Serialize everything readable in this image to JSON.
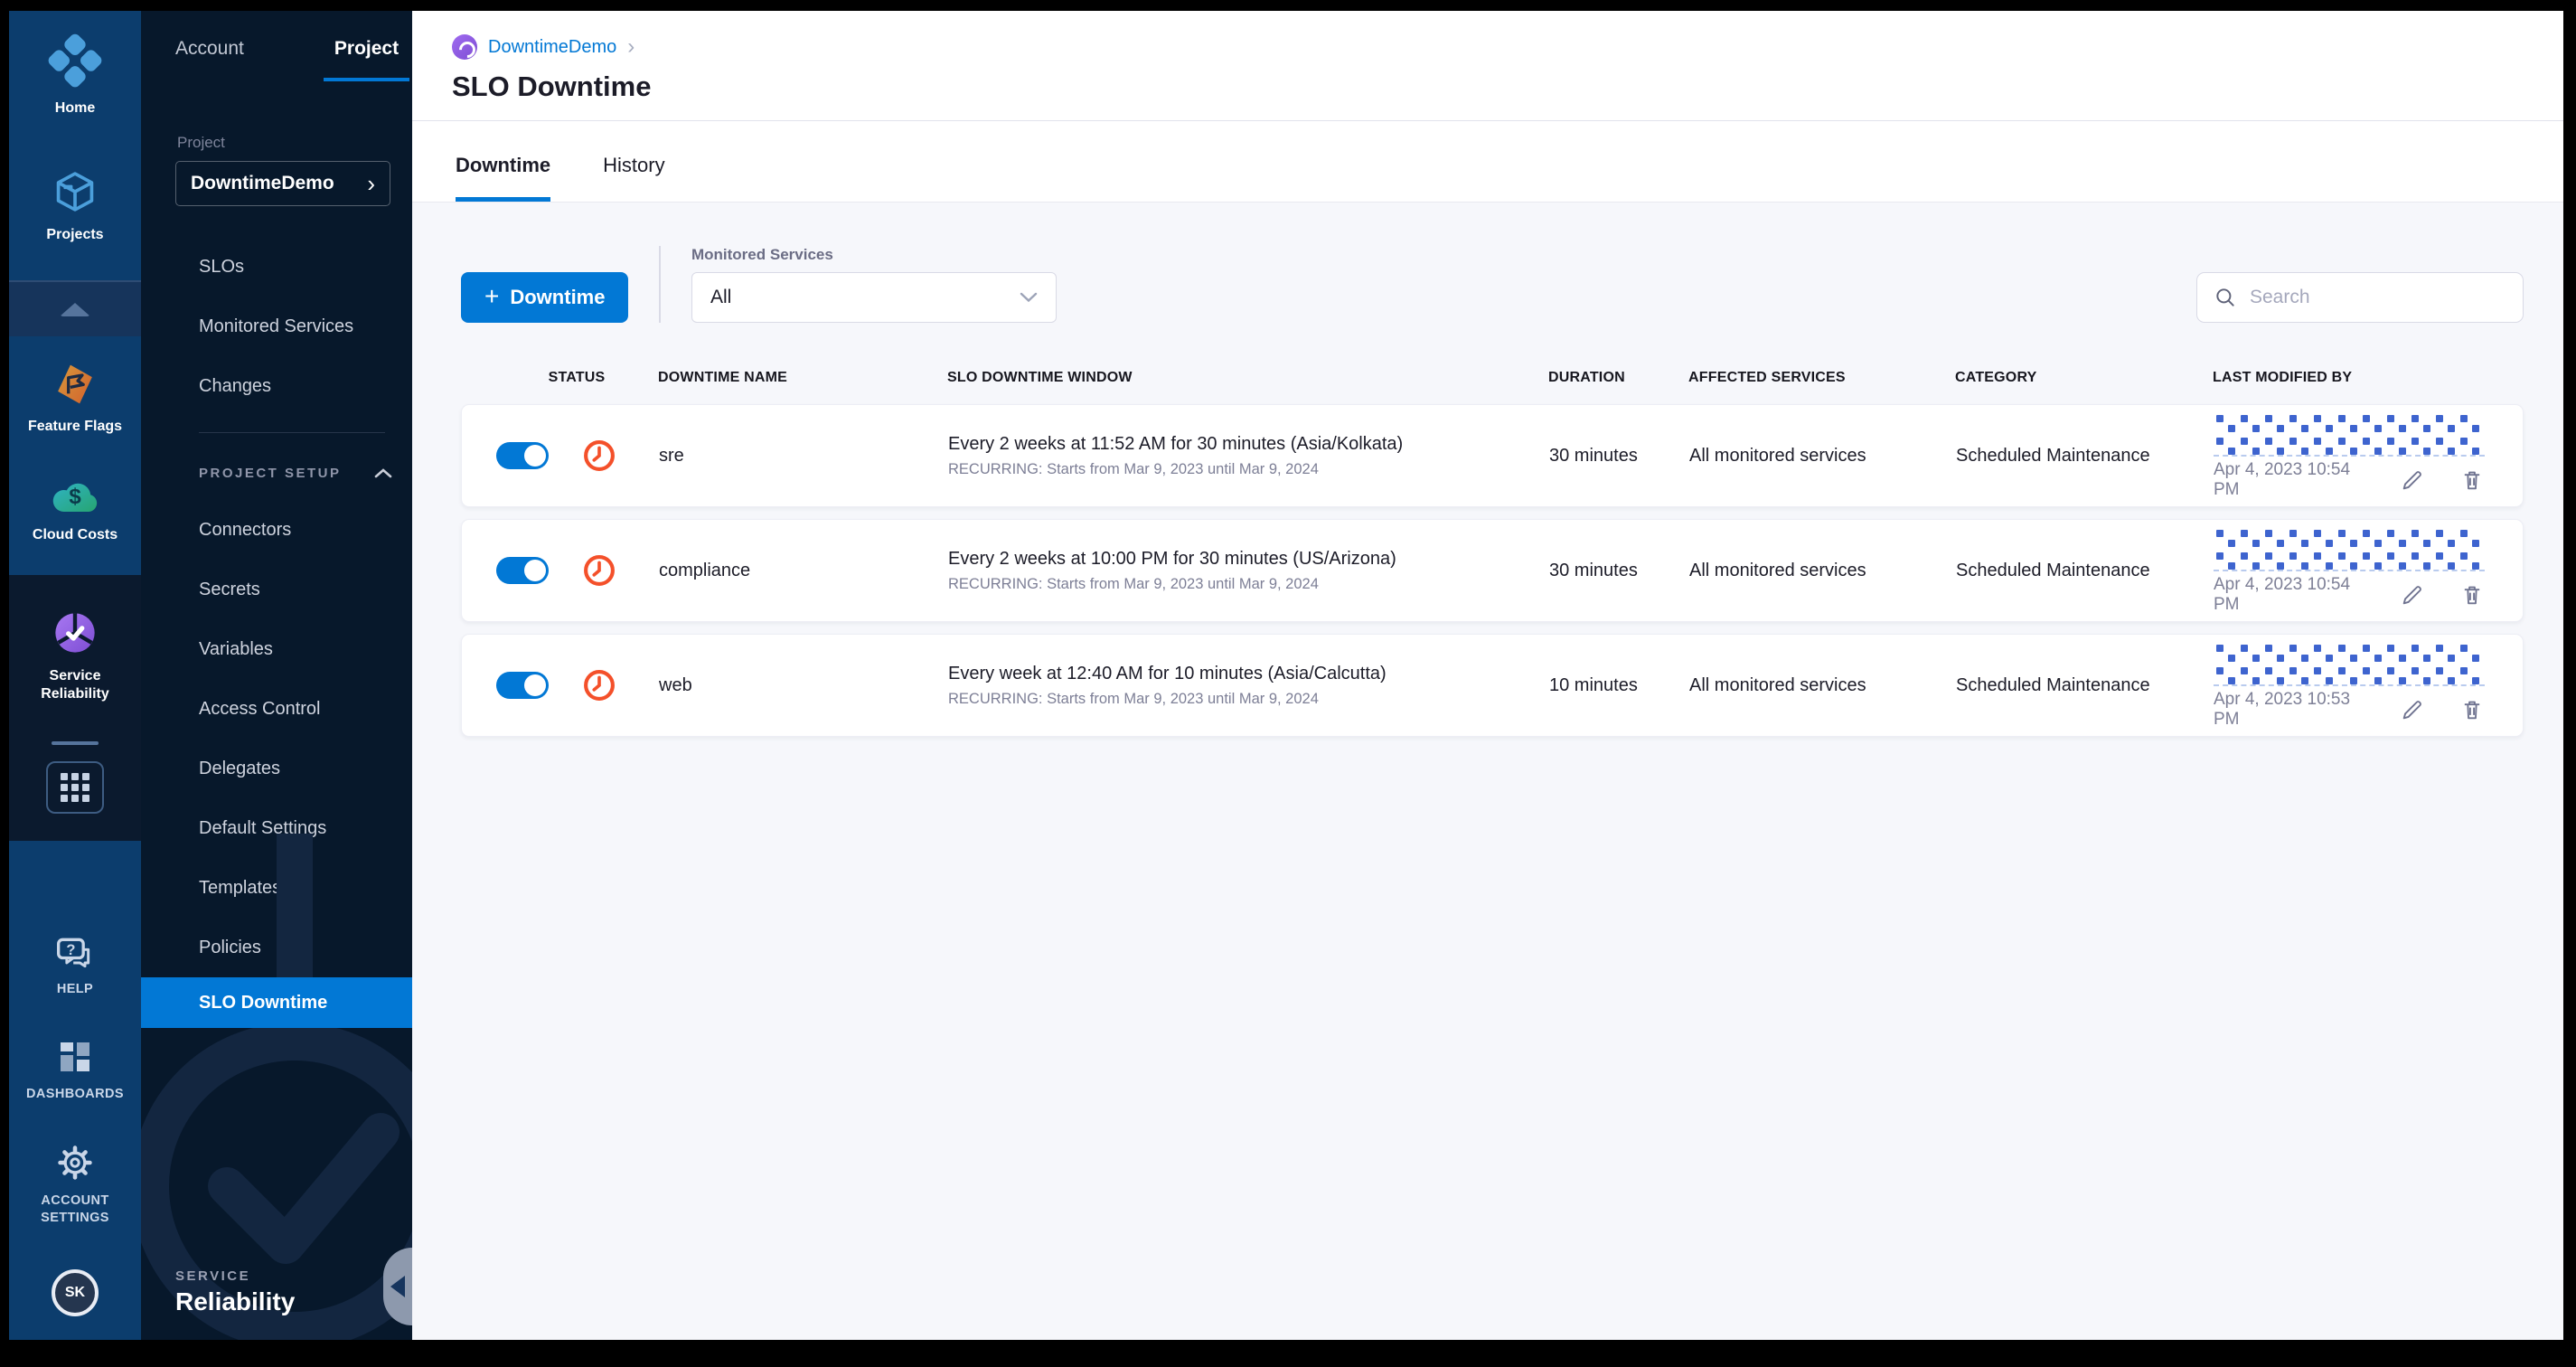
{
  "rail": {
    "home": {
      "label": "Home"
    },
    "projects": {
      "label": "Projects"
    },
    "modules": [
      {
        "label": "Feature Flags"
      },
      {
        "label": "Cloud Costs"
      },
      {
        "label": "Service Reliability",
        "selected": true
      }
    ],
    "help_label": "HELP",
    "dashboards_label": "DASHBOARDS",
    "account_settings_label_1": "ACCOUNT",
    "account_settings_label_2": "SETTINGS",
    "avatar_initials": "SK"
  },
  "nav": {
    "account_tab": "Account",
    "project_tab": "Project",
    "project_field_label": "Project",
    "project_name": "DowntimeDemo",
    "items": [
      "SLOs",
      "Monitored Services",
      "Changes"
    ],
    "section_label": "PROJECT SETUP",
    "setup_items": [
      "Connectors",
      "Secrets",
      "Variables",
      "Access Control",
      "Delegates",
      "Default Settings",
      "Templates",
      "Policies"
    ],
    "selected_item": "SLO Downtime",
    "brand_top": "SERVICE",
    "brand_bottom": "Reliability"
  },
  "header": {
    "breadcrumb_project": "DowntimeDemo",
    "breadcrumb_chevron": "›",
    "title": "SLO Downtime"
  },
  "page_tabs": [
    {
      "label": "Downtime",
      "active": true
    },
    {
      "label": "History",
      "active": false
    }
  ],
  "toolbar": {
    "plus": "+",
    "new_downtime_label": "Downtime",
    "filter_label": "Monitored Services",
    "filter_value": "All",
    "search_placeholder": "Search"
  },
  "table": {
    "headers": [
      "STATUS",
      "DOWNTIME NAME",
      "SLO DOWNTIME WINDOW",
      "DURATION",
      "AFFECTED SERVICES",
      "CATEGORY",
      "LAST MODIFIED BY"
    ],
    "rows": [
      {
        "enabled": true,
        "name": "sre",
        "window": "Every 2 weeks at 11:52 AM for 30 minutes (Asia/Kolkata)",
        "recurrence": "RECURRING: Starts from Mar 9, 2023 until Mar 9, 2024",
        "duration": "30 minutes",
        "affected_services": "All monitored services",
        "category": "Scheduled Maintenance",
        "last_modified": "Apr 4, 2023 10:54 PM"
      },
      {
        "enabled": true,
        "name": "compliance",
        "window": "Every 2 weeks at 10:00 PM for 30 minutes (US/Arizona)",
        "recurrence": "RECURRING: Starts from Mar 9, 2023 until Mar 9, 2024",
        "duration": "30 minutes",
        "affected_services": "All monitored services",
        "category": "Scheduled Maintenance",
        "last_modified": "Apr 4, 2023 10:54 PM"
      },
      {
        "enabled": true,
        "name": "web",
        "window": "Every week at 12:40 AM for 10 minutes (Asia/Calcutta)",
        "recurrence": "RECURRING: Starts from Mar 9, 2023 until Mar 9, 2024",
        "duration": "10 minutes",
        "affected_services": "All monitored services",
        "category": "Scheduled Maintenance",
        "last_modified": "Apr 4, 2023 10:53 PM"
      }
    ]
  },
  "colors": {
    "accent": "#0278D5",
    "clock_icon": "#F4502A",
    "redact_dot": "#3E64CF",
    "rail_blue": "#0C3D6D",
    "nav_dark": "#07182B"
  }
}
